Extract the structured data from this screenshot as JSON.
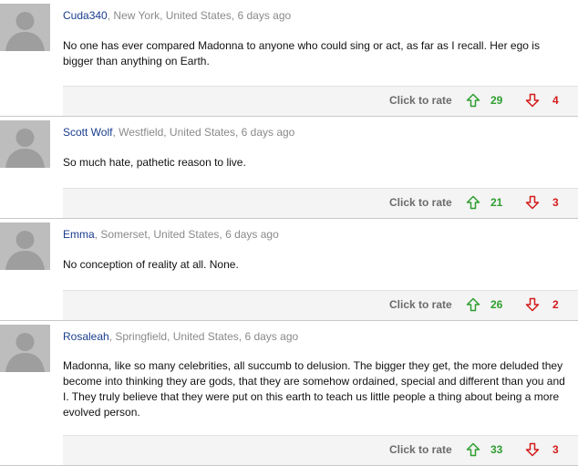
{
  "rate_label": "Click to rate",
  "colors": {
    "author": "#1a3d8f",
    "up": "#2f9e2f",
    "down": "#d41a1a"
  },
  "icons": {
    "avatar": "default-user-silhouette-icon",
    "up": "arrow-up-outline-icon",
    "down": "arrow-down-outline-icon"
  },
  "comments": [
    {
      "author": "Cuda340",
      "location": ", New York, United States, 6 days ago",
      "text": "No one has ever compared Madonna to anyone who could sing or act, as far as I recall. Her ego is bigger than anything on Earth.",
      "up": "29",
      "down": "4"
    },
    {
      "author": "Scott Wolf",
      "location": ", Westfield, United States, 6 days ago",
      "text": "So much hate, pathetic reason to live.",
      "up": "21",
      "down": "3"
    },
    {
      "author": "Emma",
      "location": ", Somerset, United States, 6 days ago",
      "text": "No conception of reality at all. None.",
      "up": "26",
      "down": "2"
    },
    {
      "author": "Rosaleah",
      "location": ", Springfield, United States, 6 days ago",
      "text": "Madonna, like so many celebrities, all succumb to delusion. The bigger they get, the more deluded they become into thinking they are gods, that they are somehow ordained, special and different than you and I. They truly believe that they were put on this earth to teach us little people a thing about being a more evolved person.",
      "up": "33",
      "down": "3"
    }
  ]
}
